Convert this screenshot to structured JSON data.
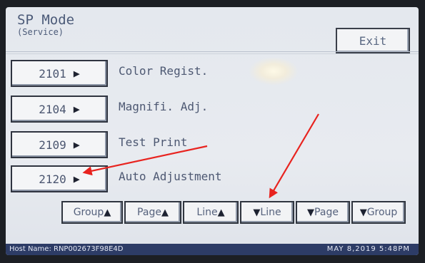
{
  "header": {
    "title": "SP Mode",
    "subtitle": "(Service)",
    "exit_label": "Exit"
  },
  "items": [
    {
      "code": "2101",
      "label": "Color Regist."
    },
    {
      "code": "2104",
      "label": "Magnifi. Adj."
    },
    {
      "code": "2109",
      "label": "Test Print"
    },
    {
      "code": "2120",
      "label": "Auto Adjustment"
    }
  ],
  "icons": {
    "item_arrow": "right-triangle-icon",
    "up": "up-triangle-icon",
    "down": "down-triangle-icon"
  },
  "nav": {
    "group_up": "Group",
    "page_up": "Page",
    "line_up": "Line",
    "line_down": "Line",
    "page_down": "Page",
    "group_down": "Group"
  },
  "status_bar": {
    "host": "Host Name: RNP002673F98E4D",
    "date": "MAY   8,2019  5:48PM"
  },
  "annotation_color": "#e8231f"
}
